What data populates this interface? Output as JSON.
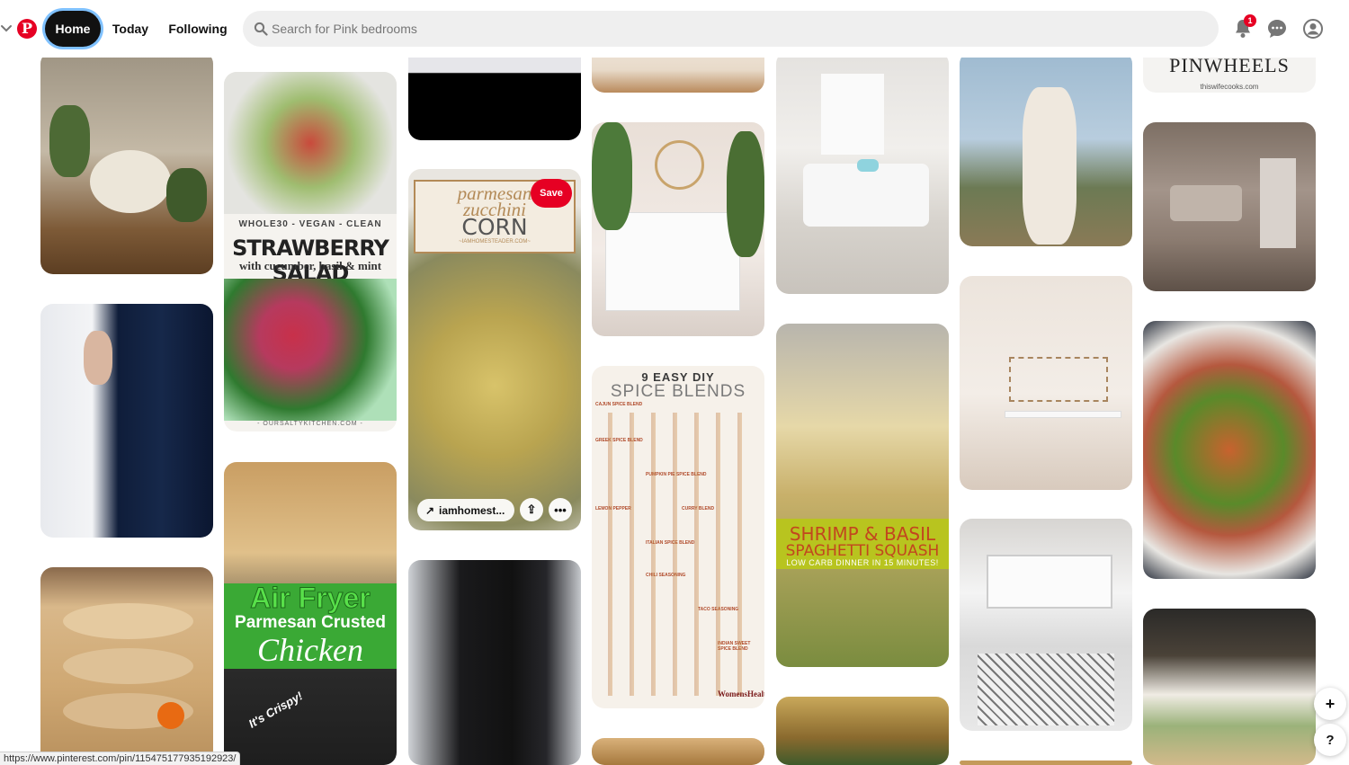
{
  "header": {
    "logo_icon": "pinterest-logo",
    "nav": {
      "home": "Home",
      "today": "Today",
      "following": "Following"
    },
    "search": {
      "placeholder": "Search for Pink bedrooms",
      "value": ""
    },
    "notifications_badge": "1",
    "icons": [
      "bell-icon",
      "chat-icon",
      "profile-icon",
      "chevron-down-icon"
    ]
  },
  "pins": [
    {
      "kind": "recipe-title",
      "overlay": {
        "top_line": "WHOLE30 - VEGAN - CLEAN",
        "title": "STRAWBERRY SALAD",
        "subtitle": "with cucumber, basil & mint",
        "source": "- OURSALTYKITCHEN.COM -"
      }
    },
    {
      "kind": "recipe-title",
      "overlay": {
        "title_line1": "Air Fryer",
        "title_line2": "Parmesan Crusted",
        "title_line3": "Chicken",
        "tag": "It's Crispy!"
      }
    },
    {
      "kind": "recipe-title",
      "overlay": {
        "line1": "parmesan",
        "line2": "zucchini",
        "line3": "CORN",
        "source": "~IAMHOMESTEADER.COM~"
      }
    },
    {
      "kind": "infographic",
      "overlay": {
        "title": "9 EASY DIY",
        "subtitle": "SPICE BLENDS",
        "sections": [
          "CAJUN SPICE BLEND",
          "GREEK SPICE BLEND",
          "PUMPKIN PIE SPICE BLEND",
          "LEMON PEPPER",
          "CURRY BLEND",
          "ITALIAN SPICE BLEND",
          "CHILI SEASONING",
          "TACO SEASONING",
          "INDIAN SWEET SPICE BLEND"
        ],
        "brand": "WomensHealth"
      }
    },
    {
      "kind": "recipe-title",
      "overlay": {
        "title": "SHRIMP & BASIL",
        "subtitle": "SPAGHETTI SQUASH",
        "tagline": "LOW CARB DINNER IN 15 MINUTES!"
      }
    },
    {
      "kind": "recipe-title",
      "overlay": {
        "title": "PINWHEELS",
        "source": "thiswifecooks.com"
      }
    }
  ],
  "hover_pin": {
    "save_label": "Save",
    "source_label": "iamhomest...",
    "icons": [
      "arrow-up-right-icon",
      "share-icon",
      "more-icon"
    ]
  },
  "status_url": "https://www.pinterest.com/pin/115475177935192923/",
  "floating": {
    "add": "+",
    "help": "?"
  },
  "colors": {
    "brand": "#e60023",
    "nav_active_bg": "#111111",
    "search_bg": "#efefef"
  }
}
